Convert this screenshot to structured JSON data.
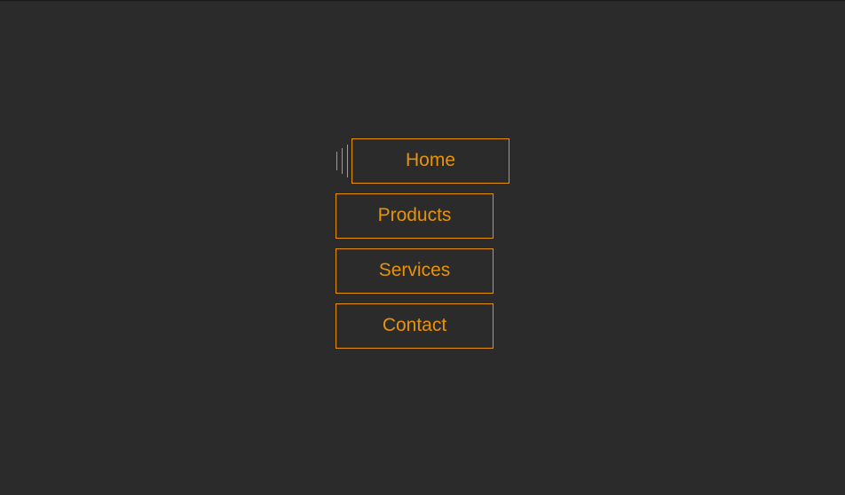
{
  "menu": {
    "items": [
      {
        "label": "Home",
        "active": true
      },
      {
        "label": "Products",
        "active": false
      },
      {
        "label": "Services",
        "active": false
      },
      {
        "label": "Contact",
        "active": false
      }
    ]
  },
  "colors": {
    "accent": "#e8920a",
    "background": "#2b2b2b"
  }
}
